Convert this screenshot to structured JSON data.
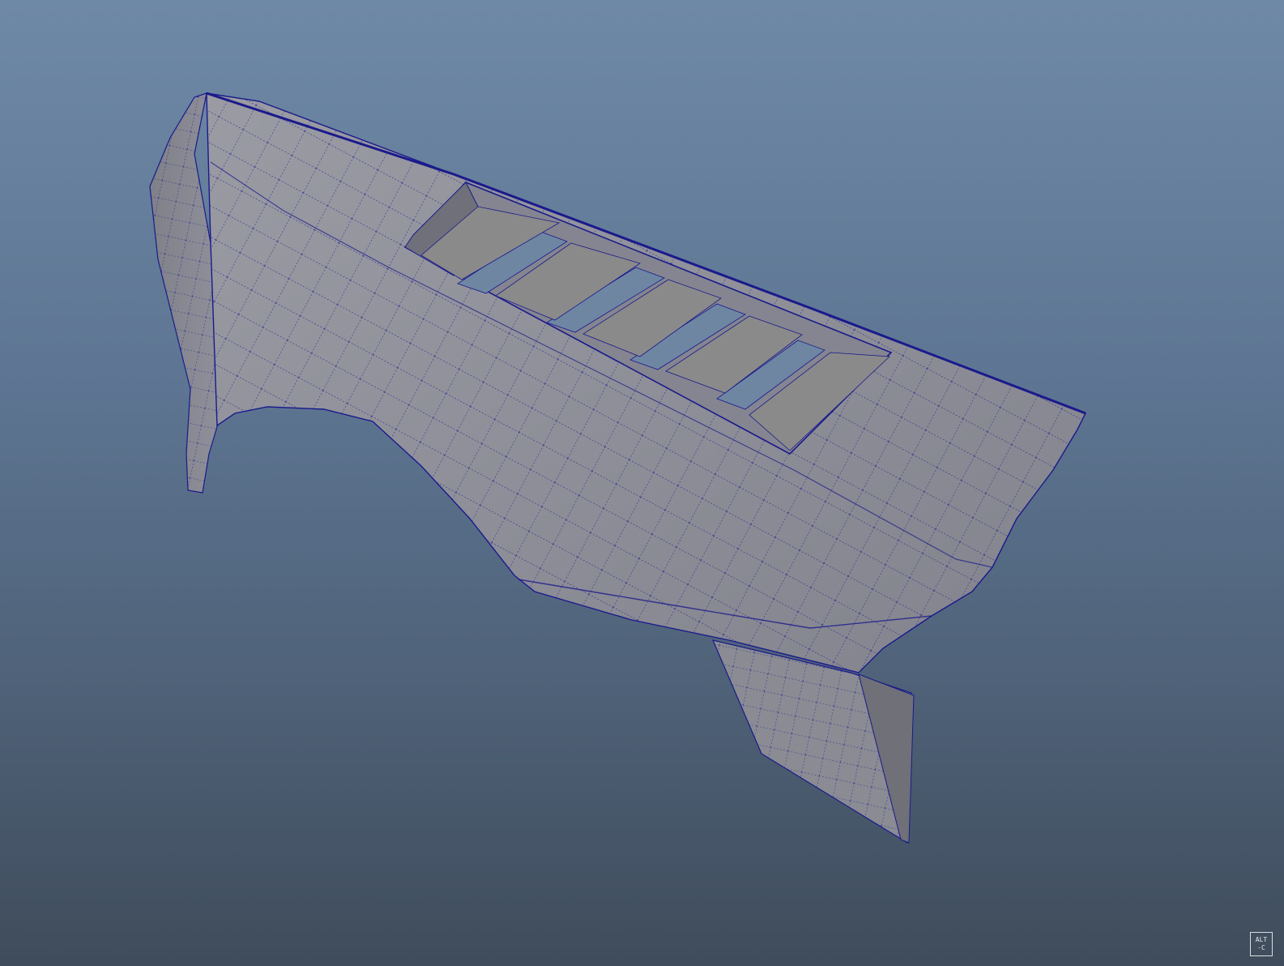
{
  "viewport": {
    "background_top": "#6e89a6",
    "background_bottom": "#3f4c5b",
    "mesh_color": "#8e8f97",
    "wire_color": "#1a1a8c",
    "opening_color": "#6f86a3"
  },
  "badge": {
    "line1": "ALT",
    "line2": "-C"
  },
  "model": {
    "icon": "polygon-mesh-fender-wireframe"
  }
}
